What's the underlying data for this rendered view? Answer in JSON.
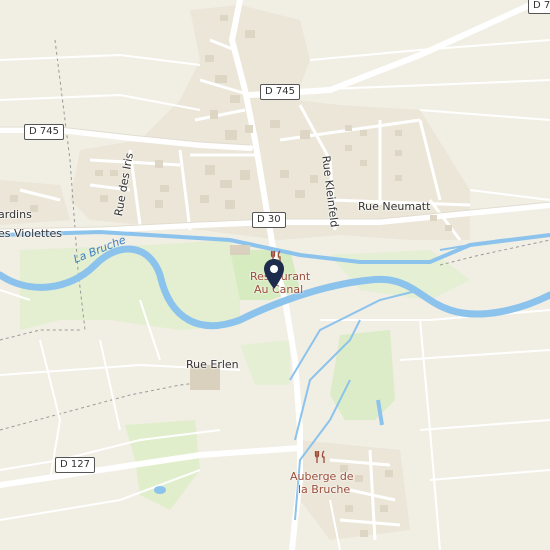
{
  "map": {
    "road_labels": {
      "d745_west": "D 745",
      "d745_north": "D 745",
      "d7_corner": "D 7",
      "d30": "D 30",
      "d127": "D 127"
    },
    "street_labels": {
      "rue_des_iris": "Rue des Iris",
      "rue_kleinfeld": "Rue Kleinfeld",
      "rue_neumatt": "Rue Neumatt",
      "rue_erlen": "Rue Erlen",
      "rue_violettes": "es Violettes",
      "rue_jardins": "ardins"
    },
    "water_labels": {
      "la_bruche": "La Bruche"
    },
    "pois": {
      "restaurant_canal": {
        "line1": "Restaurant",
        "line2": "Au Canal",
        "icon": "fork-knife-icon"
      },
      "auberge": {
        "line1": "Auberge de",
        "line2": "la Bruche",
        "icon": "fork-knife-icon"
      }
    },
    "marker": {
      "icon": "location-pin-icon",
      "color": "#1d2c4d"
    },
    "colors": {
      "land": "#f1eee4",
      "field": "#f5f2ea",
      "water": "#8cc3ec",
      "green": "#d9ebc4",
      "road": "#ffffff",
      "buildings": "#e6e1d4"
    }
  }
}
